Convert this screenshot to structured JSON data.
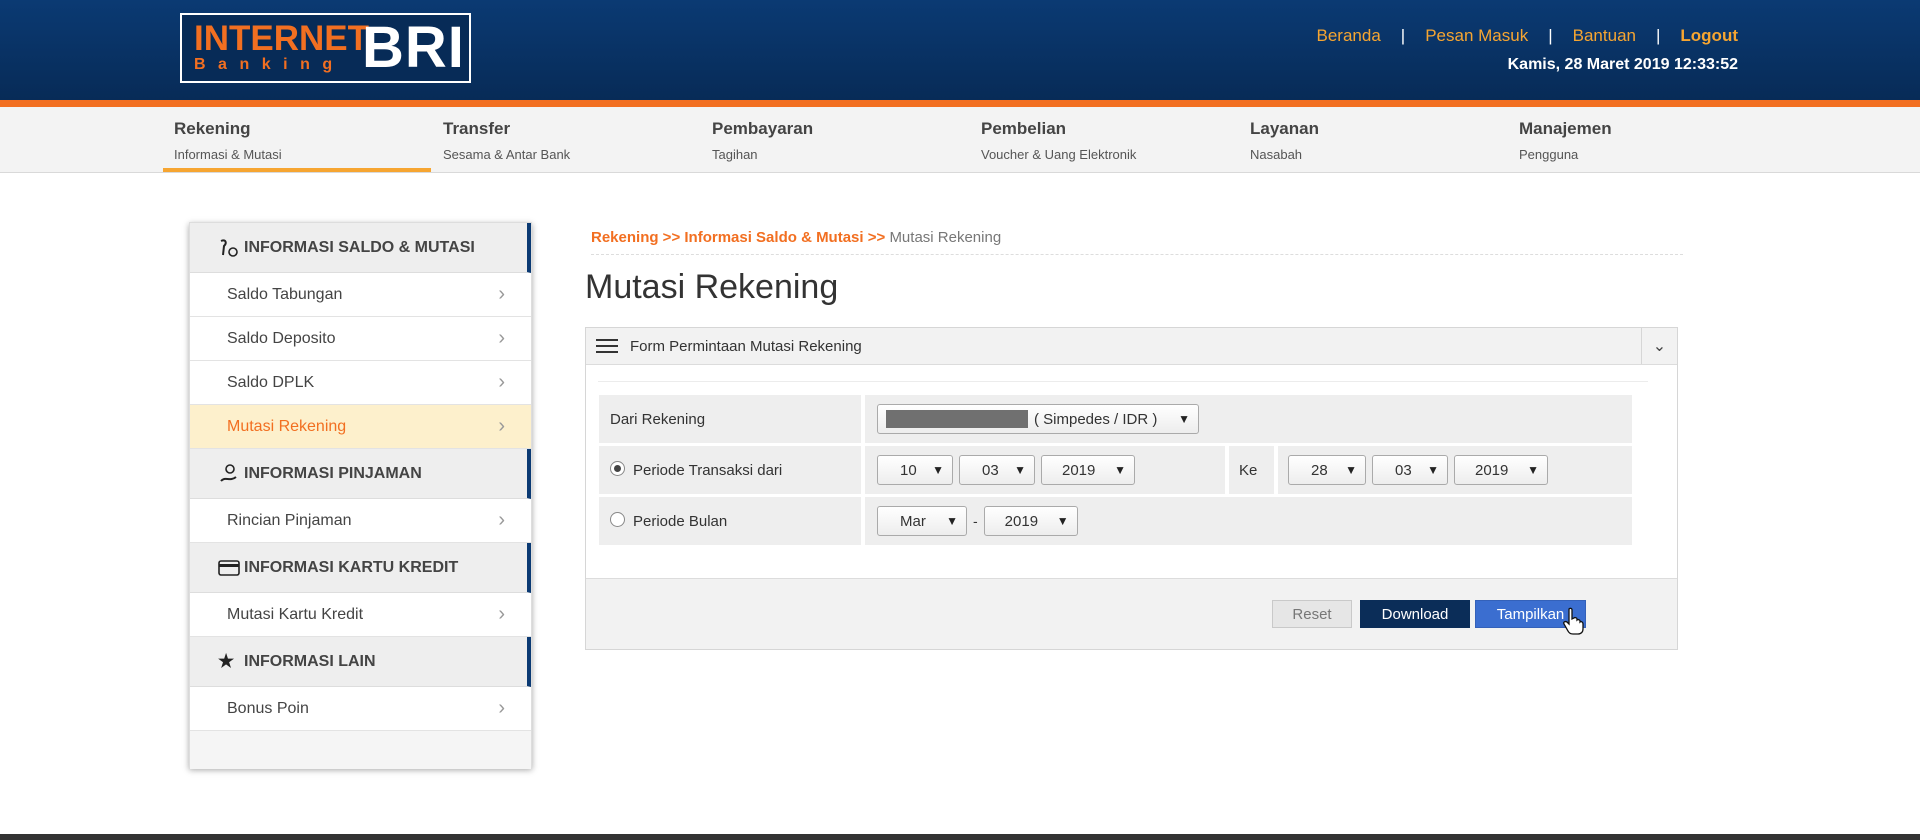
{
  "header": {
    "logo": {
      "line1": "INTERNET",
      "line2": "Banking",
      "brand": "BRI"
    },
    "links": {
      "beranda": "Beranda",
      "pesan": "Pesan Masuk",
      "bantuan": "Bantuan",
      "logout": "Logout",
      "separator": "|"
    },
    "datetime": "Kamis, 28 Maret 2019 12:33:52"
  },
  "nav": [
    {
      "title": "Rekening",
      "sub": "Informasi & Mutasi"
    },
    {
      "title": "Transfer",
      "sub": "Sesama & Antar Bank"
    },
    {
      "title": "Pembayaran",
      "sub": "Tagihan"
    },
    {
      "title": "Pembelian",
      "sub": "Voucher & Uang Elektronik"
    },
    {
      "title": "Layanan",
      "sub": "Nasabah"
    },
    {
      "title": "Manajemen",
      "sub": "Pengguna"
    }
  ],
  "sidebar": {
    "sections": [
      {
        "title": "INFORMASI SALDO & MUTASI",
        "items": [
          "Saldo Tabungan",
          "Saldo Deposito",
          "Saldo DPLK",
          "Mutasi Rekening"
        ]
      },
      {
        "title": "INFORMASI PINJAMAN",
        "items": [
          "Rincian Pinjaman"
        ]
      },
      {
        "title": "INFORMASI KARTU KREDIT",
        "items": [
          "Mutasi Kartu Kredit"
        ]
      },
      {
        "title": "INFORMASI LAIN",
        "items": [
          "Bonus Poin"
        ]
      }
    ]
  },
  "breadcrumb": {
    "part1": "Rekening >> ",
    "part2": "Informasi Saldo & Mutasi >> ",
    "current": "Mutasi Rekening"
  },
  "page_title": "Mutasi Rekening",
  "form": {
    "title": "Form Permintaan Mutasi Rekening",
    "dari_rekening_label": "Dari Rekening",
    "rekening_suffix": "( Simpedes / IDR )",
    "periode_transaksi_label": "Periode Transaksi dari",
    "from_day": "10",
    "from_month": "03",
    "from_year": "2019",
    "ke_label": "Ke",
    "to_day": "28",
    "to_month": "03",
    "to_year": "2019",
    "periode_bulan_label": "Periode Bulan",
    "bulan": "Mar",
    "dash": "-",
    "bulan_year": "2019"
  },
  "buttons": {
    "reset": "Reset",
    "download": "Download",
    "tampilkan": "Tampilkan"
  },
  "colors": {
    "header_blue": "#0b3a73",
    "accent_orange": "#f26f21",
    "link_orange": "#f6a531",
    "button_blue": "#3b6ed0",
    "button_navy": "#0b2d58"
  },
  "icons": {
    "section1": "saldo-mutasi-icon",
    "section2": "pinjaman-icon",
    "section3": "credit-card-icon",
    "section4": "star-icon"
  }
}
